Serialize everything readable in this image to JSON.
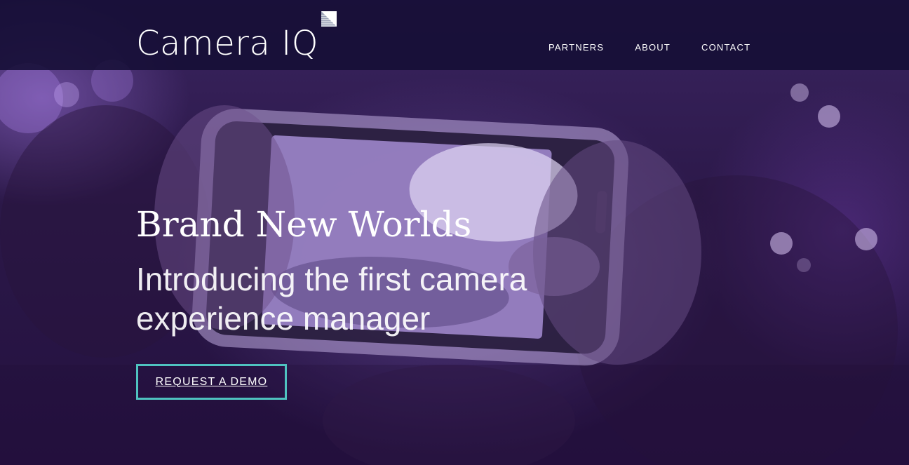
{
  "brand": {
    "name": "Camera IQ",
    "logo_icon": "striped-triangle-mark-icon"
  },
  "nav": {
    "items": [
      {
        "label": "PARTNERS"
      },
      {
        "label": "ABOUT"
      },
      {
        "label": "CONTACT"
      }
    ]
  },
  "hero": {
    "title": "Brand New Worlds",
    "subtitle": "Introducing the first camera experience manager",
    "cta_label": "REQUEST A DEMO",
    "background_image": "hands-holding-smartphone-photo"
  },
  "colors": {
    "nav_bar": "#140e34",
    "cta_border": "#4fc3c0",
    "overlay_tint": "#3a2460"
  }
}
